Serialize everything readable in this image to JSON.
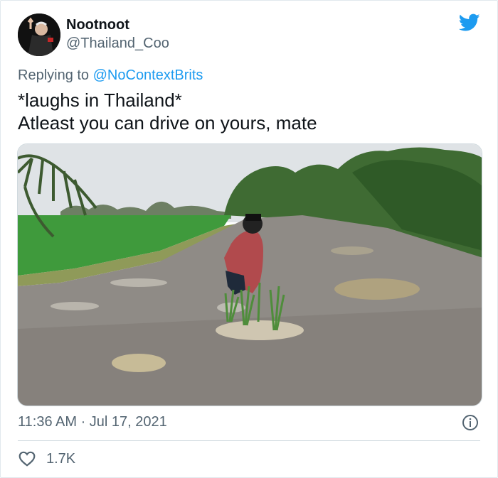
{
  "tweet": {
    "author": {
      "display_name": "Nootnoot",
      "handle": "@Thailand_Coo",
      "avatar_icon": "person-avatar"
    },
    "replying_label": "Replying to ",
    "replying_to": "@NoContextBrits",
    "text": "*laughs in Thailand*\nAtleast you can drive on yours, mate",
    "timestamp": "11:36 AM · Jul 17, 2021",
    "like_count": "1.7K",
    "icons": {
      "brand": "twitter-bird-icon",
      "info": "info-icon",
      "like": "heart-icon"
    }
  },
  "colors": {
    "brand": "#1d9bf0",
    "secondary_text": "#536471",
    "primary_text": "#0f1419"
  }
}
